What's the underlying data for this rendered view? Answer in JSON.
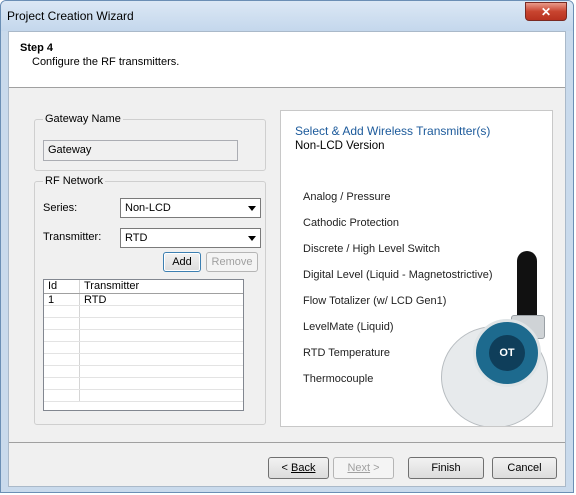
{
  "window": {
    "title": "Project Creation Wizard",
    "close_glyph": "✕"
  },
  "header": {
    "step": "Step 4",
    "description": "Configure the RF transmitters."
  },
  "gateway": {
    "legend": "Gateway Name",
    "value": "Gateway"
  },
  "rf_network": {
    "legend": "RF Network",
    "series_label": "Series:",
    "series_value": "Non-LCD",
    "transmitter_label": "Transmitter:",
    "transmitter_value": "RTD",
    "add_label": "Add",
    "remove_label": "Remove",
    "columns": [
      "Id",
      "Transmitter"
    ],
    "rows": [
      {
        "id": "1",
        "transmitter": "RTD"
      }
    ]
  },
  "panel": {
    "title": "Select & Add Wireless Transmitter(s)",
    "subtitle": "Non-LCD Version",
    "items": [
      "Analog / Pressure",
      "Cathodic Protection",
      "Discrete / High Level Switch",
      "Digital Level (Liquid - Magnetostrictive)",
      "Flow Totalizer (w/ LCD Gen1)",
      "LevelMate (Liquid)",
      "RTD Temperature",
      "Thermocouple"
    ],
    "device_logo": "OT",
    "device_icon": "wireless-transmitter-image"
  },
  "footer": {
    "back_label": "Back",
    "next_label": "Next",
    "finish_label": "Finish",
    "cancel_label": "Cancel"
  }
}
